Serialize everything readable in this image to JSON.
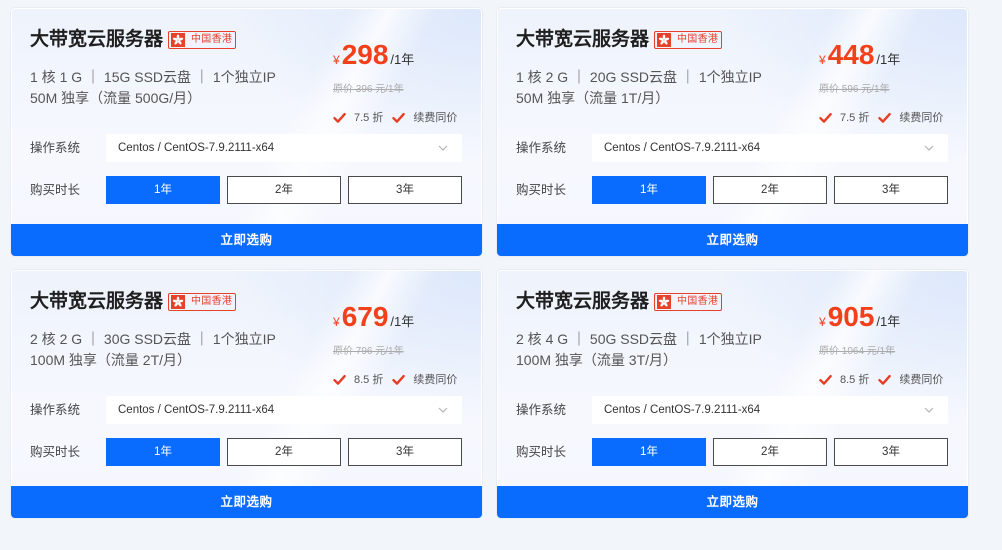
{
  "colors": {
    "page_background": "#f2f5fa",
    "accent": "#0a6bff",
    "price": "#f2401b",
    "badge": "#e8412b",
    "check": "#e63d24"
  },
  "icons": {
    "region": "hong-kong-flag-icon",
    "feature": "check-icon",
    "select": "chevron-down-icon"
  },
  "plans": [
    {
      "title": "大带宽云服务器",
      "region": "中国香港",
      "spec_config": "1 核 1 G ｜ 15G SSD云盘 ｜ 1个独立IP",
      "spec_bandwidth": "50M 独享（流量 500G/月）",
      "currency": "¥",
      "price": "298",
      "period": "/1年",
      "original_price": "原价 396 元/1年",
      "discount": "7.5 折",
      "renewal": "续费同价",
      "os_label": "操作系统",
      "os_value": "Centos / CentOS-7.9.2111-x64",
      "duration_label": "购买时长",
      "durations": [
        {
          "label": "1年",
          "selected": true
        },
        {
          "label": "2年",
          "selected": false
        },
        {
          "label": "3年",
          "selected": false
        }
      ],
      "buy_label": "立即选购"
    },
    {
      "title": "大带宽云服务器",
      "region": "中国香港",
      "spec_config": "1 核 2 G ｜ 20G SSD云盘 ｜ 1个独立IP",
      "spec_bandwidth": "50M 独享（流量 1T/月）",
      "currency": "¥",
      "price": "448",
      "period": "/1年",
      "original_price": "原价 596 元/1年",
      "discount": "7.5 折",
      "renewal": "续费同价",
      "os_label": "操作系统",
      "os_value": "Centos / CentOS-7.9.2111-x64",
      "duration_label": "购买时长",
      "durations": [
        {
          "label": "1年",
          "selected": true
        },
        {
          "label": "2年",
          "selected": false
        },
        {
          "label": "3年",
          "selected": false
        }
      ],
      "buy_label": "立即选购"
    },
    {
      "title": "大带宽云服务器",
      "region": "中国香港",
      "spec_config": "2 核 2 G ｜ 30G SSD云盘 ｜ 1个独立IP",
      "spec_bandwidth": "100M 独享（流量 2T/月）",
      "currency": "¥",
      "price": "679",
      "period": "/1年",
      "original_price": "原价 796 元/1年",
      "discount": "8.5 折",
      "renewal": "续费同价",
      "os_label": "操作系统",
      "os_value": "Centos / CentOS-7.9.2111-x64",
      "duration_label": "购买时长",
      "durations": [
        {
          "label": "1年",
          "selected": true
        },
        {
          "label": "2年",
          "selected": false
        },
        {
          "label": "3年",
          "selected": false
        }
      ],
      "buy_label": "立即选购"
    },
    {
      "title": "大带宽云服务器",
      "region": "中国香港",
      "spec_config": "2 核 4 G ｜ 50G SSD云盘 ｜ 1个独立IP",
      "spec_bandwidth": "100M 独享（流量 3T/月）",
      "currency": "¥",
      "price": "905",
      "period": "/1年",
      "original_price": "原价 1064 元/1年",
      "discount": "8.5 折",
      "renewal": "续费同价",
      "os_label": "操作系统",
      "os_value": "Centos / CentOS-7.9.2111-x64",
      "duration_label": "购买时长",
      "durations": [
        {
          "label": "1年",
          "selected": true
        },
        {
          "label": "2年",
          "selected": false
        },
        {
          "label": "3年",
          "selected": false
        }
      ],
      "buy_label": "立即选购"
    }
  ]
}
